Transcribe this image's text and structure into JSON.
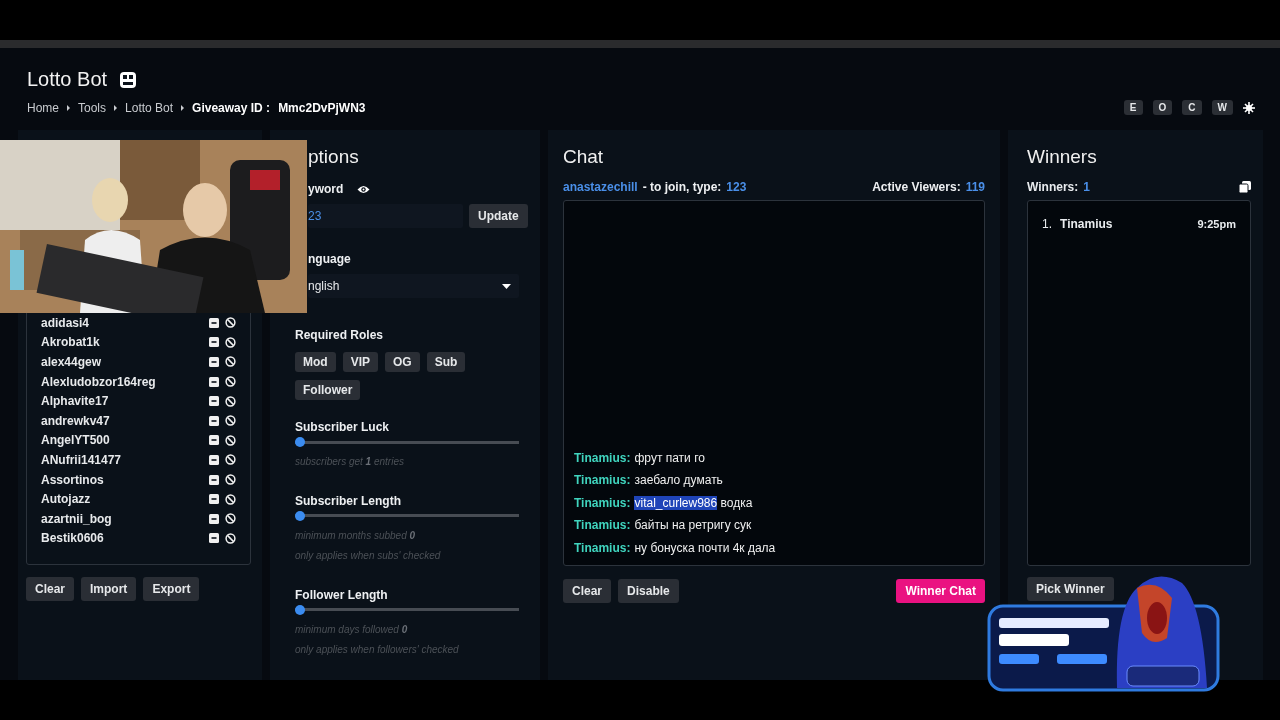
{
  "page": {
    "title": "Lotto Bot",
    "breadcrumb": [
      "Home",
      "Tools",
      "Lotto Bot"
    ],
    "giveaway_label": "Giveaway ID :",
    "giveaway_id": "Mmc2DvPjWN3",
    "header_buttons": [
      "E",
      "O",
      "C",
      "W"
    ]
  },
  "entrants": {
    "items": [
      "adidasi4",
      "Akrobat1k",
      "alex44gew",
      "Alexludobzor164reg",
      "Alphavite17",
      "andrewkv47",
      "AngelYT500",
      "ANufrii141477",
      "Assortinos",
      "Autojazz",
      "azartnii_bog",
      "Bestik0606"
    ],
    "buttons": [
      "Clear",
      "Import",
      "Export"
    ]
  },
  "options": {
    "title": "ptions",
    "keyword_label": "yword",
    "keyword_value": "23",
    "update_button": "Update",
    "language_label": "nguage",
    "language_value": "nglish",
    "roles_label": "Required Roles",
    "roles": [
      {
        "label": "Mod",
        "selected": false
      },
      {
        "label": "VIP",
        "selected": false
      },
      {
        "label": "OG",
        "selected": false
      },
      {
        "label": "Sub",
        "selected": false
      },
      {
        "label": "Follower",
        "selected": false
      }
    ],
    "sliders": [
      {
        "label": "Subscriber Luck",
        "level": 0,
        "notes": [
          "subscribers get **1** entries"
        ]
      },
      {
        "label": "Subscriber Length",
        "level": 0,
        "notes": [
          "minimum months subbed **0**",
          "only applies when subs' checked"
        ]
      },
      {
        "label": "Follower Length",
        "level": 0,
        "notes": [
          "minimum days followed **0**",
          "only applies when followers' checked"
        ]
      }
    ]
  },
  "chat": {
    "title": "Chat",
    "channel": "anastazechill",
    "join_text": "- to join, type:",
    "keyword": "123",
    "viewers_label": "Active Viewers:",
    "viewers": "119",
    "messages": [
      {
        "user": "Tinamius:",
        "text": "фрут пати го"
      },
      {
        "user": "Tinamius:",
        "text": "заебало думать"
      },
      {
        "user": "Tinamius:",
        "highlight": "vital_curlew986",
        "text": "водка"
      },
      {
        "user": "Tinamius:",
        "text": "байты на ретригу сук"
      },
      {
        "user": "Tinamius:",
        "text": "ну бонуска почти 4к дала"
      }
    ],
    "buttons": [
      "Clear",
      "Disable"
    ],
    "winner_chat_button": "Winner Chat"
  },
  "winners": {
    "title": "Winners",
    "count_label": "Winners:",
    "count": "1",
    "items": [
      {
        "rank": "1.",
        "name": "Tinamius",
        "time": "9:25pm"
      }
    ],
    "pick_button": "Pick Winner"
  }
}
